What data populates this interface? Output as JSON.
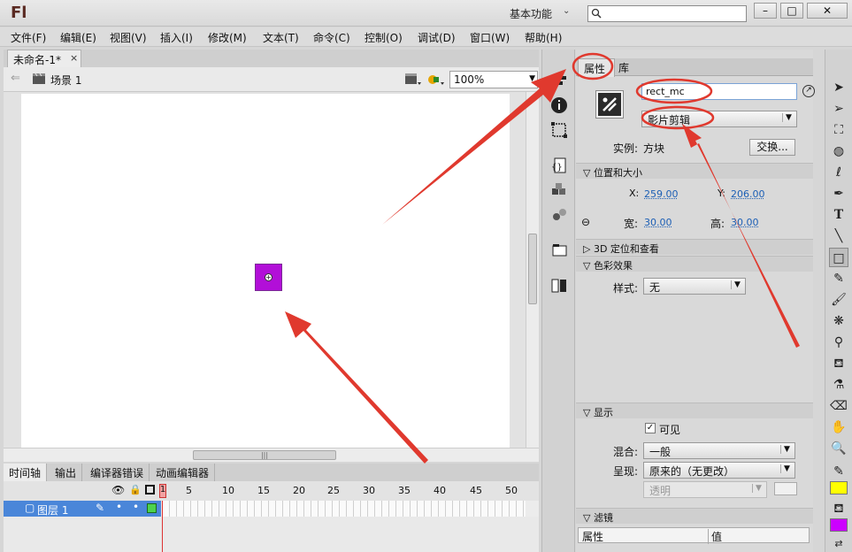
{
  "app": {
    "logo": "Fl",
    "workspace": "基本功能",
    "workspace_arrow": "⌄",
    "search_placeholder": ""
  },
  "window_controls": {
    "minimize": "–",
    "maximize": "□",
    "close": "✕"
  },
  "menu": [
    "文件(F)",
    "编辑(E)",
    "视图(V)",
    "插入(I)",
    "修改(M)",
    "文本(T)",
    "命令(C)",
    "控制(O)",
    "调试(D)",
    "窗口(W)",
    "帮助(H)"
  ],
  "document": {
    "tab_title": "未命名-1*",
    "tab_close": "×",
    "scene": "场景 1",
    "zoom": "100%"
  },
  "timeline": {
    "tabs": [
      "时间轴",
      "输出",
      "编译器错误",
      "动画编辑器"
    ],
    "frame_numbers": [
      "1",
      "5",
      "10",
      "15",
      "20",
      "25",
      "30",
      "35",
      "40",
      "45",
      "50"
    ],
    "layer_name": "图层 1",
    "current_frame": "1"
  },
  "properties": {
    "tabs": [
      "属性",
      "库"
    ],
    "instance_name": "rect_mc",
    "instance_type": "影片剪辑",
    "instance_of_label": "实例:",
    "instance_of_value": "方块",
    "swap_button": "交换...",
    "section_position": "位置和大小",
    "x_label": "X:",
    "x_value": "259.00",
    "y_label": "Y:",
    "y_value": "206.00",
    "width_label": "宽:",
    "width_value": "30.00",
    "height_label": "高:",
    "height_value": "30.00",
    "section_3d": "3D 定位和查看",
    "section_color": "色彩效果",
    "style_label": "样式:",
    "style_value": "无",
    "section_display": "显示",
    "visible_label": "可见",
    "blend_label": "混合:",
    "blend_value": "一般",
    "render_label": "呈现:",
    "render_value": "原来的（无更改）",
    "transparent_value": "透明",
    "section_filters": "滤镜",
    "filter_col_property": "属性",
    "filter_col_value": "值"
  },
  "colors": {
    "stroke_color": "#ffff00",
    "fill_color": "#cc00ff",
    "square_color": "#b20fd8",
    "annotation_red": "#e0392e"
  }
}
